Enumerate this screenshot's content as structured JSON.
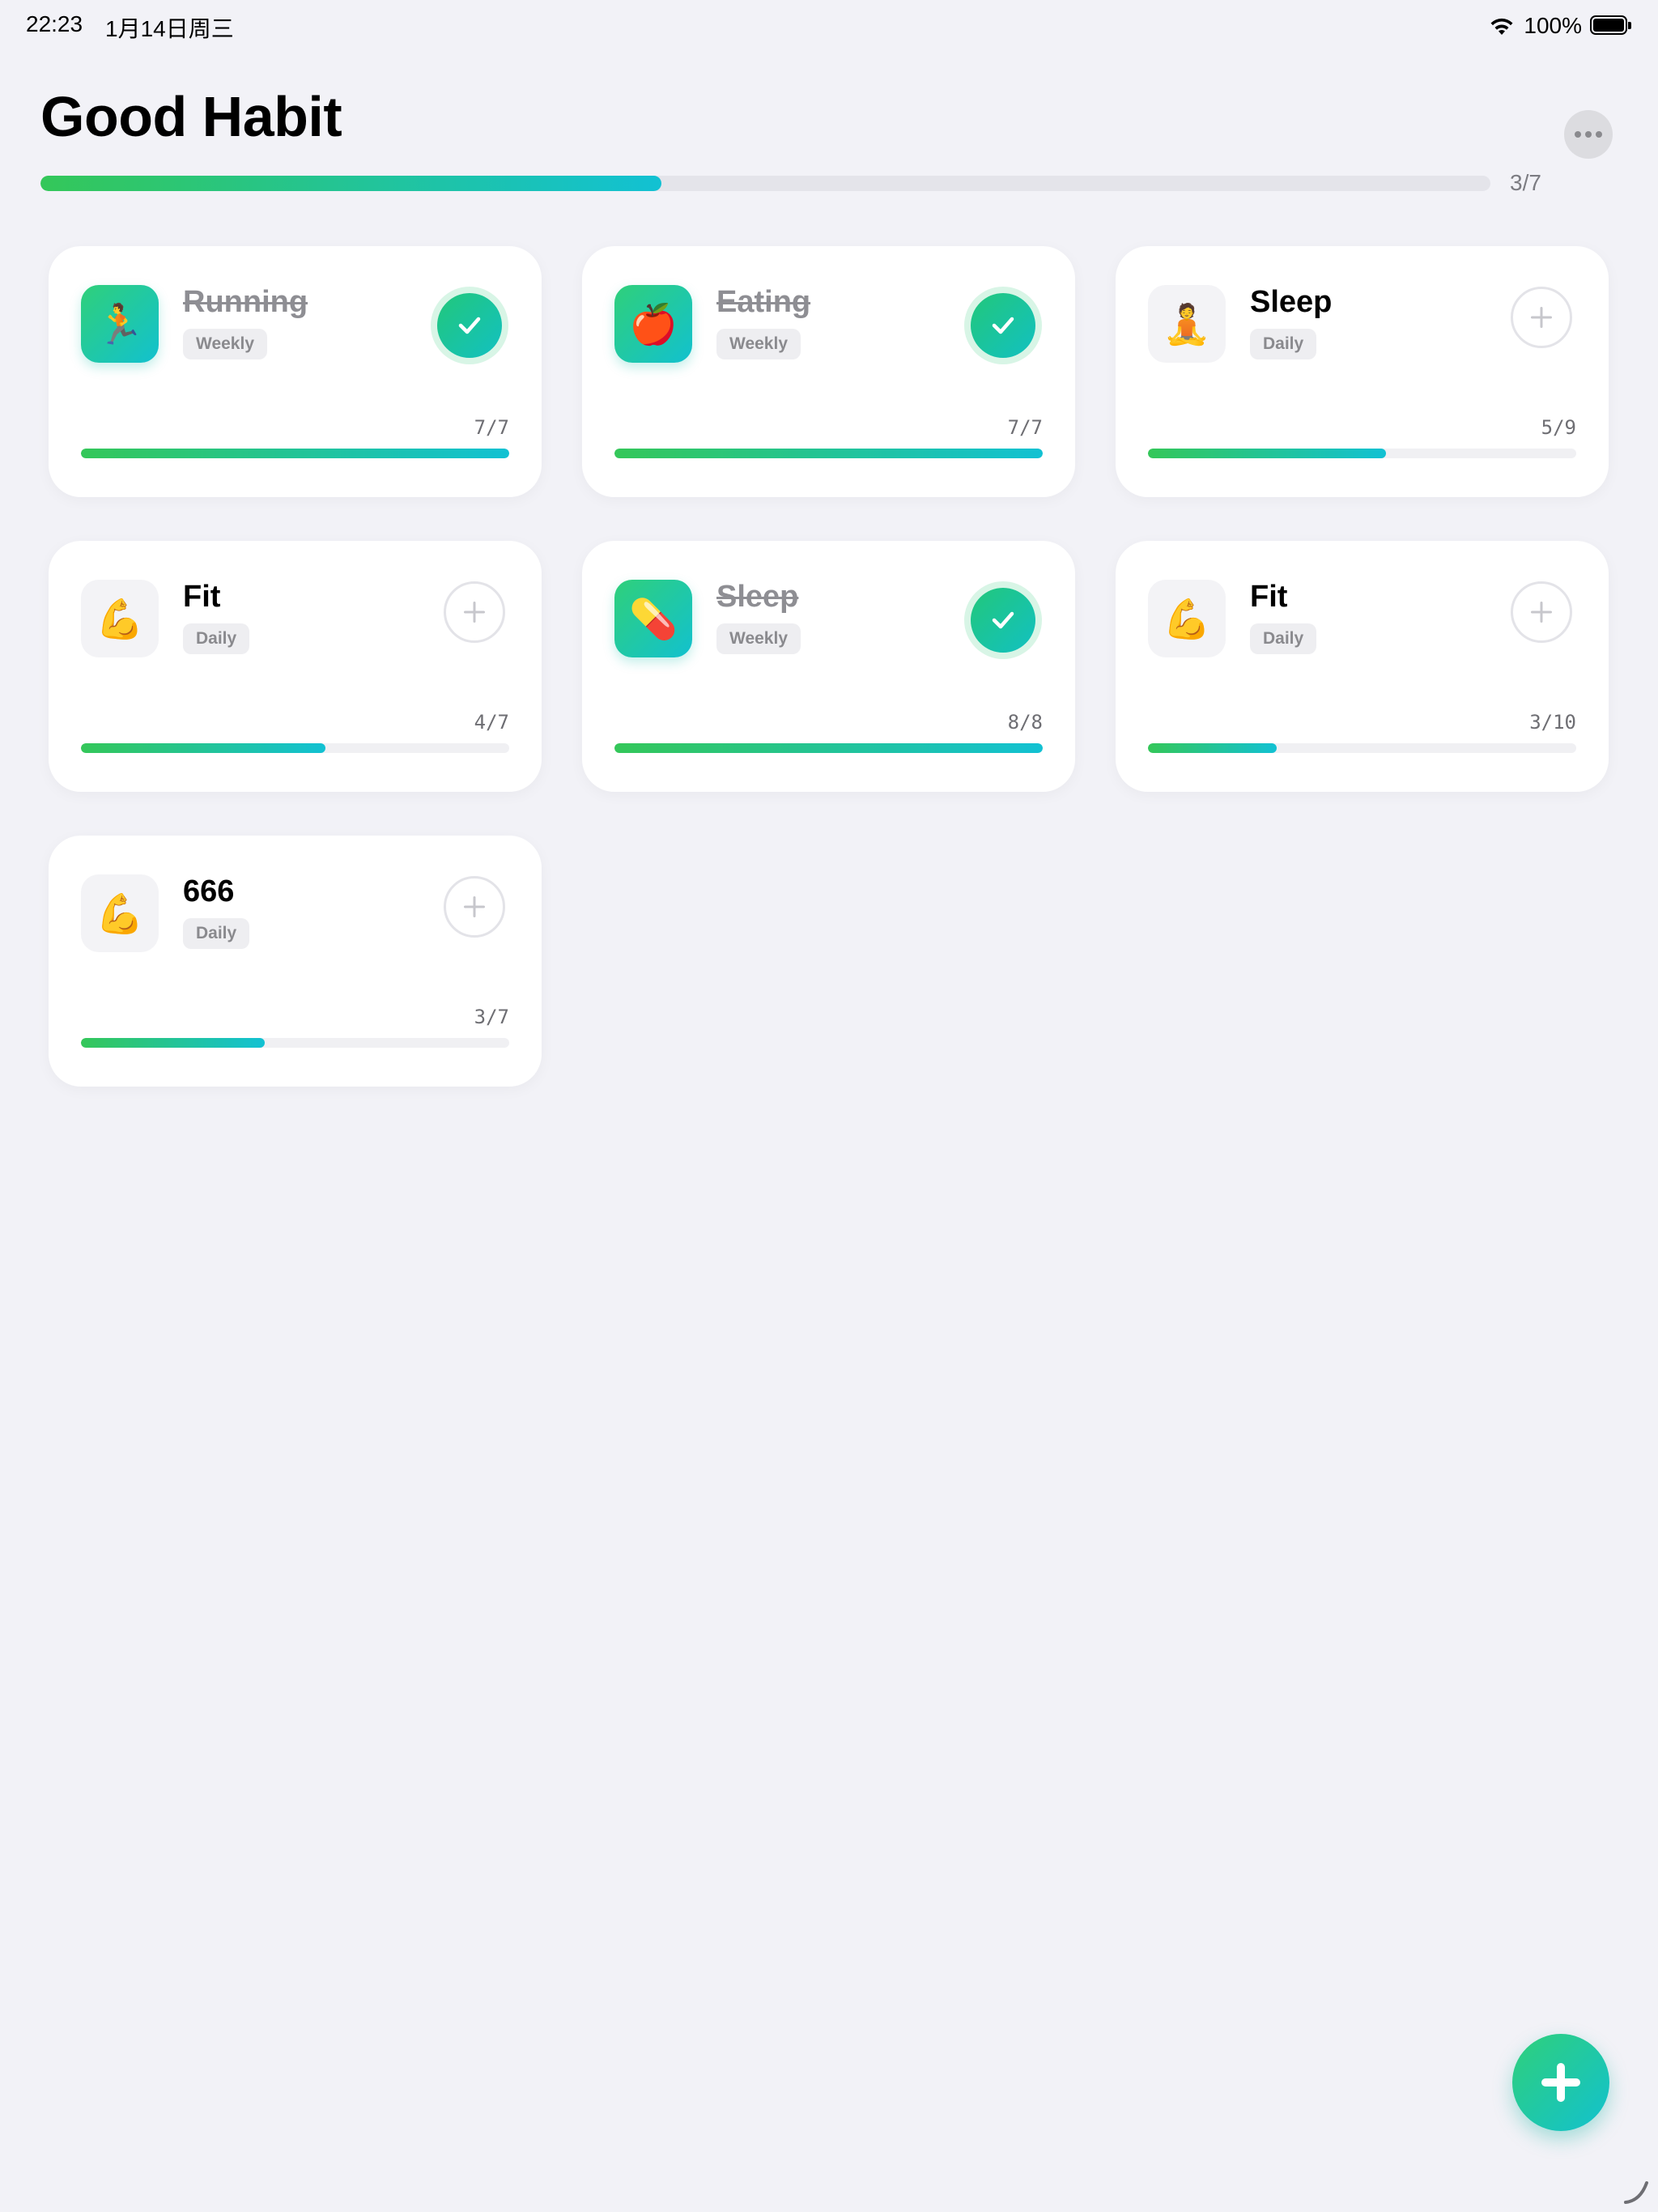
{
  "status_bar": {
    "time": "22:23",
    "date": "1月14日周三",
    "battery": "100%"
  },
  "header": {
    "title": "Good Habit",
    "progress_text": "3/7",
    "progress_fraction": 0.428
  },
  "colors": {
    "accent_start": "#34c759",
    "accent_end": "#12c1d3",
    "background": "#f2f2f7"
  },
  "habits": [
    {
      "name": "Running",
      "frequency": "Weekly",
      "icon": "running-icon",
      "emoji": "🏃",
      "count_text": "7/7",
      "done": 7,
      "target": 7,
      "completed": true
    },
    {
      "name": "Eating",
      "frequency": "Weekly",
      "icon": "apple-icon",
      "emoji": "🍎",
      "count_text": "7/7",
      "done": 7,
      "target": 7,
      "completed": true
    },
    {
      "name": "Sleep",
      "frequency": "Daily",
      "icon": "meditation-icon",
      "emoji": "🧘",
      "count_text": "5/9",
      "done": 5,
      "target": 9,
      "completed": false
    },
    {
      "name": "Fit",
      "frequency": "Daily",
      "icon": "flexed-biceps-icon",
      "emoji": "💪",
      "count_text": "4/7",
      "done": 4,
      "target": 7,
      "completed": false
    },
    {
      "name": "Sleep",
      "frequency": "Weekly",
      "icon": "pill-icon",
      "emoji": "💊",
      "count_text": "8/8",
      "done": 8,
      "target": 8,
      "completed": true
    },
    {
      "name": "Fit",
      "frequency": "Daily",
      "icon": "flexed-biceps-icon",
      "emoji": "💪",
      "count_text": "3/10",
      "done": 3,
      "target": 10,
      "completed": false
    },
    {
      "name": "666",
      "frequency": "Daily",
      "icon": "flexed-biceps-icon",
      "emoji": "💪",
      "count_text": "3/7",
      "done": 3,
      "target": 7,
      "completed": false
    }
  ]
}
